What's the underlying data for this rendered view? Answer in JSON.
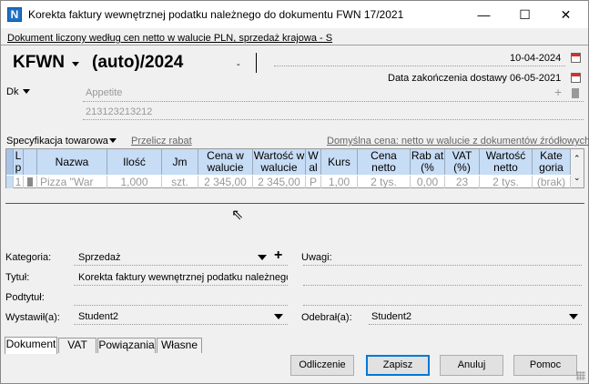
{
  "window": {
    "title": "Korekta faktury wewnętrznej podatku należnego do dokumentu FWN 17/2021",
    "app_icon_letter": "N",
    "controls": {
      "minimize": "—",
      "maximize": "☐",
      "close": "✕"
    }
  },
  "header": {
    "subtitle": "Dokument liczony według cen netto w walucie PLN, sprzedaż krajowa - S",
    "doc_prefix": "KFWN",
    "doc_number": "(auto)/2024",
    "doc_dash": "-",
    "date_issue": "10-04-2024",
    "delivery_label": "Data zakończenia dostawy",
    "delivery_date": "06-05-2021"
  },
  "party": {
    "label": "Dk",
    "name": "Appetite",
    "nip": "213123213212"
  },
  "spec": {
    "spec_label": "Specyfikacja towarowa",
    "recalc_label": "Przelicz rabat",
    "price_info": "Domyślna cena: netto w walucie z dokumentów źródłowych"
  },
  "table": {
    "columns": [
      "L p",
      "Nazwa",
      "Ilość",
      "Jm",
      "Cena w walucie",
      "Wartość w walucie",
      "W al",
      "Kurs",
      "Cena netto",
      "Rab at (%",
      "VAT (%)",
      "Wartość netto",
      "Kate goria"
    ],
    "rows": [
      [
        "1",
        "Pizza \"War",
        "1,000",
        "szt.",
        "2 345,00",
        "2 345,00",
        "P",
        "1,00",
        "2 tys.",
        "0,00",
        "23",
        "2 tys.",
        "(brak)"
      ]
    ]
  },
  "form": {
    "category_label": "Kategoria:",
    "category_value": "Sprzedaż",
    "title_label": "Tytuł:",
    "title_value": "Korekta faktury wewnętrznej podatku należnego",
    "subtitle_label": "Podtytuł:",
    "subtitle_value": "",
    "issued_label": "Wystawił(a):",
    "issued_value": "Student2",
    "remarks_label": "Uwagi:",
    "received_label": "Odebrał(a):",
    "received_value": "Student2"
  },
  "tabs": [
    "Dokument",
    "VAT",
    "Powiązania",
    "Własne"
  ],
  "buttons": {
    "offset": "Odliczenie",
    "save": "Zapisz",
    "cancel": "Anuluj",
    "help": "Pomoc"
  }
}
